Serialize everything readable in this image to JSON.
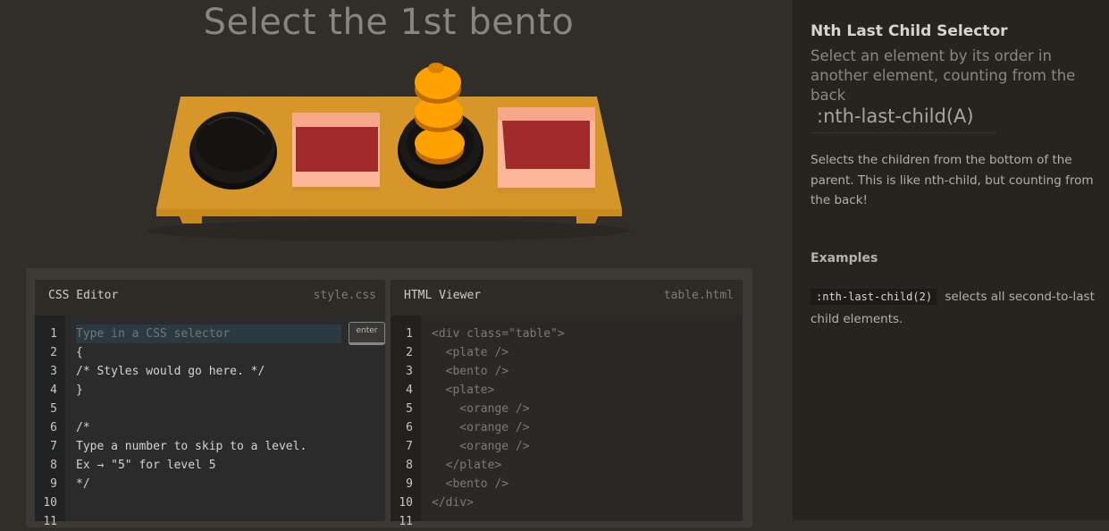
{
  "level": {
    "instruction": "Select the 1st bento"
  },
  "scene": {
    "colors": {
      "table_top": "#d7962a",
      "table_front": "#c98a22",
      "plate": "#151413",
      "bento_box": "#fbb69a",
      "bento_fill": "#a12a2a",
      "orange": "#ffa200"
    },
    "items": [
      "plate",
      "bento",
      "plate-with-oranges",
      "bento"
    ]
  },
  "css_editor": {
    "title": "CSS Editor",
    "filename": "style.css",
    "input_placeholder": "Type in a CSS selector",
    "enter_label": "enter",
    "line_numbers": [
      "1",
      "2",
      "3",
      "4",
      "5",
      "6",
      "7",
      "8",
      "9",
      "10",
      "11"
    ],
    "lines": [
      "{",
      "/* Styles would go here. */",
      "}",
      "",
      "/*",
      "Type a number to skip to a level.",
      "Ex → \"5\" for level 5",
      "*/"
    ]
  },
  "html_viewer": {
    "title": "HTML Viewer",
    "filename": "table.html",
    "line_numbers": [
      "1",
      "2",
      "3",
      "4",
      "5",
      "6",
      "7",
      "8",
      "9",
      "10",
      "11"
    ],
    "lines": [
      "<div class=\"table\">",
      "  <plate />",
      "  <bento />",
      "  <plate>",
      "    <orange />",
      "    <orange />",
      "    <orange />",
      "  </plate>",
      "  <bento />",
      "</div>"
    ]
  },
  "help": {
    "title": "Nth Last Child Selector",
    "subtitle": "Select an element by its order in another element, counting from the back",
    "syntax": ":nth-last-child(A)",
    "description": "Selects the children from the bottom of the parent. This is like nth-child, but counting from the back!",
    "examples_heading": "Examples",
    "example_code": ":nth-last-child(2)",
    "example_text": "selects all second-to-last child elements."
  }
}
